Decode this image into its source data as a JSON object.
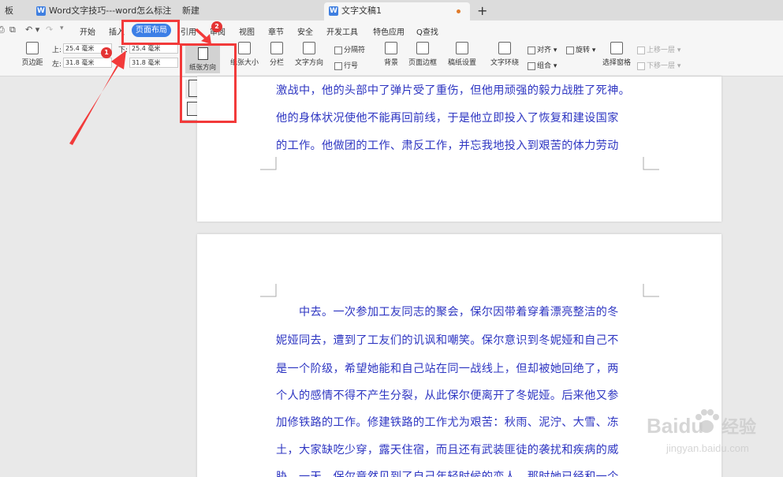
{
  "tabs": [
    {
      "label": "板"
    },
    {
      "label": "Word文字技巧---word怎么标注"
    },
    {
      "label": "新建"
    },
    {
      "label": "文字文稿1",
      "icon": "W"
    }
  ],
  "new_tab": "+",
  "menu": {
    "items": [
      "开始",
      "插入",
      "页面布局",
      "引用",
      "审阅",
      "视图",
      "章节",
      "安全",
      "开发工具",
      "特色应用"
    ],
    "active": "页面布局",
    "search": "Q查找"
  },
  "ribbon": {
    "margins_label": "页边距",
    "top_label": "上:",
    "top_value": "25.4 毫米",
    "bottom_label": "下:",
    "bottom_value": "25.4 毫米",
    "left_label": "左:",
    "left_value": "31.8 毫米",
    "right_value": "31.8 毫米",
    "orientation": "纸张方向",
    "paper_size": "纸张大小",
    "columns": "分栏",
    "text_direction": "文字方向",
    "breaks": "分隔符",
    "line_numbers": "行号",
    "background": "背景",
    "page_border": "页面边框",
    "draft_settings": "稿纸设置",
    "wrap_text": "文字环绕",
    "align": "对齐",
    "rotate": "旋转",
    "group": "组合",
    "selection_pane": "选择窗格",
    "bring_forward": "上移一层",
    "send_backward": "下移一层"
  },
  "orientation_menu": {
    "portrait": "纵向",
    "landscape": "横向"
  },
  "badges": {
    "one": "1",
    "two": "2"
  },
  "document": {
    "page1_lines": [
      "激战中，他的头部中了弹片受了重伤，但他用顽强的毅力战胜了死神。",
      "他的身体状况使他不能再回前线，于是他立即投入了恢复和建设国家",
      "的工作。他做团的工作、肃反工作，并忘我地投入到艰苦的体力劳动"
    ],
    "page2_lines": [
      "　　中去。一次参加工友同志的聚会，保尔因带着穿着漂亮整洁的冬",
      "妮娅同去，遭到了工友们的讥讽和嘲笑。保尔意识到冬妮娅和自己不",
      "是一个阶级，希望她能和自己站在同一战线上，但却被她回绝了，两",
      "个人的感情不得不产生分裂，从此保尔便离开了冬妮娅。后来他又参",
      "加修铁路的工作。修建铁路的工作尤为艰苦：秋雨、泥泞、大雪、冻",
      "土，大家缺吃少穿，露天住宿，而且还有武装匪徒的袭扰和疾病的威",
      "胁。一天，保尔竟然见到了自己年轻时候的恋人，那时她已经和一个"
    ]
  },
  "watermark": {
    "brand": "Baidu",
    "cn": "经验",
    "url": "jingyan.baidu.com"
  },
  "colors": {
    "accent": "#3d7fe6",
    "annotation": "#f23a3a",
    "doc_text": "#2e36c2"
  }
}
